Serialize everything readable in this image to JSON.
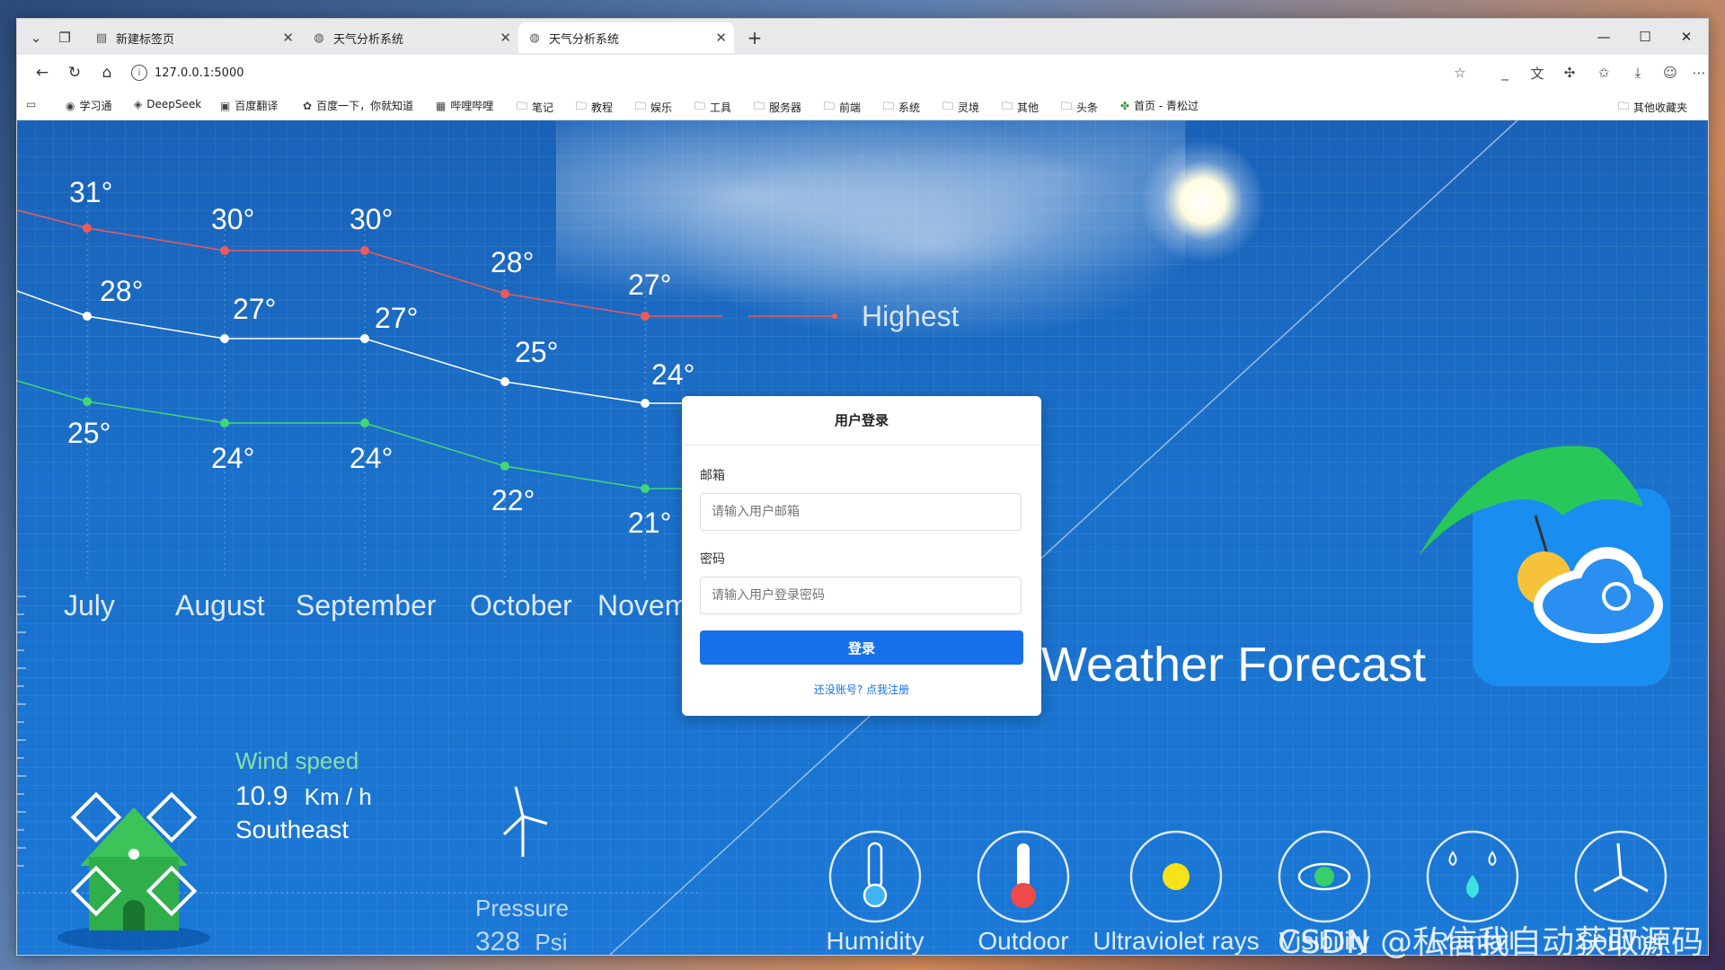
{
  "browser": {
    "tabs": [
      {
        "label": "新建标签页",
        "icon": "new-tab-icon",
        "active": false
      },
      {
        "label": "天气分析系统",
        "icon": "globe-icon",
        "active": false
      },
      {
        "label": "天气分析系统",
        "icon": "globe-icon",
        "active": true
      }
    ],
    "url": "127.0.0.1:5000"
  },
  "bookmarks": {
    "items": [
      {
        "label": "学习通"
      },
      {
        "label": "DeepSeek"
      },
      {
        "label": "百度翻译"
      },
      {
        "label": "百度一下，你就知道"
      },
      {
        "label": "哔哩哔哩"
      },
      {
        "label": "笔记"
      },
      {
        "label": "教程"
      },
      {
        "label": "娱乐"
      },
      {
        "label": "工具"
      },
      {
        "label": "服务器"
      },
      {
        "label": "前端"
      },
      {
        "label": "系统"
      },
      {
        "label": "灵境"
      },
      {
        "label": "其他"
      },
      {
        "label": "头条"
      },
      {
        "label": "首页 - 青松过"
      }
    ],
    "other": "其他收藏夹"
  },
  "weather": {
    "months": [
      "July",
      "August",
      "September",
      "October",
      "Novem"
    ],
    "highest_label": "Highest",
    "high_temps": [
      "31°",
      "30°",
      "30°",
      "28°",
      "27°"
    ],
    "mid_temps": [
      "28°",
      "27°",
      "27°",
      "25°",
      "24°"
    ],
    "low_temps": [
      "25°",
      "24°",
      "24°",
      "22°",
      "21°"
    ],
    "title": "Weather Forecast",
    "wind": {
      "label": "Wind speed",
      "value": "10.9",
      "unit": "Km / h",
      "direction": "Southeast"
    },
    "pressure": {
      "label": "Pressure",
      "value": "328",
      "unit": "Psi"
    },
    "indicators": [
      "Humidity",
      "Outdoor",
      "Ultraviolet rays",
      "Visibility",
      "Rainfall",
      "Souther"
    ],
    "colors": {
      "high": "#ee5a5a",
      "mid": "#ffffff",
      "low": "#3fd877"
    }
  },
  "login": {
    "title": "用户登录",
    "email_label": "邮箱",
    "email_placeholder": "请输入用户邮箱",
    "password_label": "密码",
    "password_placeholder": "请输入用户登录密码",
    "button": "登录",
    "register_link": "还没账号? 点我注册"
  },
  "watermark": "CSDN @私信我自动获取源码"
}
